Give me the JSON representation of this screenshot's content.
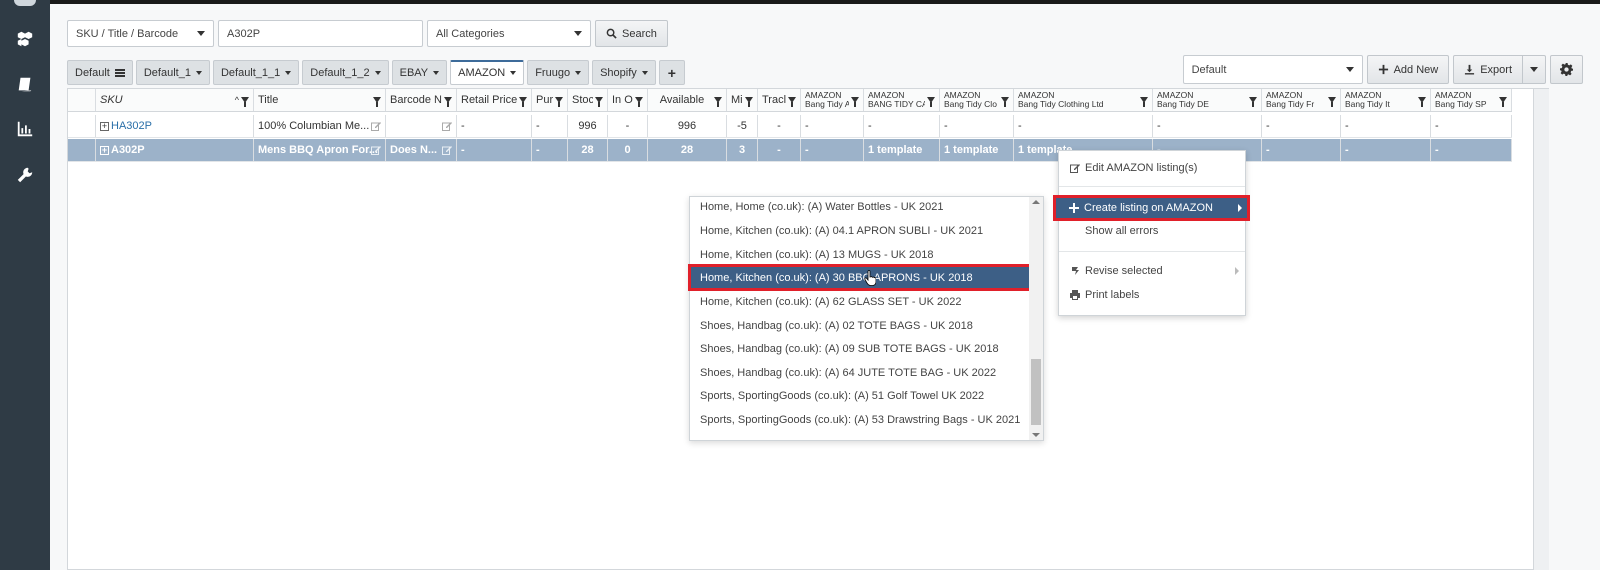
{
  "search": {
    "field_select": "SKU / Title / Barcode",
    "query": "A302P",
    "category_select": "All Categories",
    "search_label": "Search"
  },
  "tabs": [
    {
      "label": "Default"
    },
    {
      "label": "Default_1"
    },
    {
      "label": "Default_1_1"
    },
    {
      "label": "Default_1_2"
    },
    {
      "label": "EBAY"
    },
    {
      "label": "AMAZON"
    },
    {
      "label": "Fruugo"
    },
    {
      "label": "Shopify"
    },
    {
      "label": "+"
    }
  ],
  "toolbar": {
    "view_select": "Default",
    "add_new_label": "Add New",
    "export_label": "Export"
  },
  "grid": {
    "headers": [
      {
        "label": "SKU",
        "sub": ""
      },
      {
        "label": "Title",
        "sub": ""
      },
      {
        "label": "Barcode N",
        "sub": ""
      },
      {
        "label": "Retail Price",
        "sub": ""
      },
      {
        "label": "Purc",
        "sub": ""
      },
      {
        "label": "Stocl",
        "sub": ""
      },
      {
        "label": "In O",
        "sub": ""
      },
      {
        "label": "Available",
        "sub": ""
      },
      {
        "label": "Mi",
        "sub": ""
      },
      {
        "label": "Tracl",
        "sub": ""
      },
      {
        "label": "AMAZON",
        "sub": "Bang Tidy A"
      },
      {
        "label": "AMAZON",
        "sub": "BANG TIDY CA"
      },
      {
        "label": "AMAZON",
        "sub": "Bang Tidy Clo"
      },
      {
        "label": "AMAZON",
        "sub": "Bang Tidy Clothing Ltd"
      },
      {
        "label": "AMAZON",
        "sub": "Bang Tidy DE"
      },
      {
        "label": "AMAZON",
        "sub": "Bang Tidy Fr"
      },
      {
        "label": "AMAZON",
        "sub": "Bang Tidy It"
      },
      {
        "label": "AMAZON",
        "sub": "Bang Tidy SP"
      }
    ],
    "rows": [
      {
        "sku": "HA302P",
        "title": "100% Columbian Me...",
        "barcode": "",
        "retail": "-",
        "purchase": "-",
        "stock": "996",
        "in_order": "-",
        "available": "996",
        "min": "-5",
        "track": "-",
        "c1": "-",
        "c2": "-",
        "c3": "-",
        "c4": "-",
        "c5": "-",
        "c6": "-",
        "c7": "-",
        "c8": "-"
      },
      {
        "sku": "A302P",
        "title": "Mens BBQ Apron For...",
        "barcode": "Does N...",
        "retail": "-",
        "purchase": "-",
        "stock": "28",
        "in_order": "0",
        "available": "28",
        "min": "3",
        "track": "-",
        "c1": "-",
        "c2": "1 template",
        "c3": "1 template",
        "c4": "1 template",
        "c5": "-",
        "c6": "-",
        "c7": "-",
        "c8": "-"
      }
    ]
  },
  "template_list": [
    "Home, Home (co.uk): (A) Water Bottles - UK 2021",
    "Home, Kitchen (co.uk): (A) 04.1 APRON SUBLI - UK 2021",
    "Home, Kitchen (co.uk): (A) 13 MUGS - UK 2018",
    "Home, Kitchen (co.uk): (A) 30 BBQ APRONS - UK 2018",
    "Home, Kitchen (co.uk): (A) 62 GLASS SET - UK 2022",
    "Shoes, Handbag (co.uk): (A) 02 TOTE BAGS - UK 2018",
    "Shoes, Handbag (co.uk): (A) 09 SUB TOTE BAGS - UK 2018",
    "Shoes, Handbag (co.uk): (A) 64 JUTE TOTE BAG - UK 2022",
    "Sports, SportingGoods (co.uk): (A) 51 Golf Towel UK 2022",
    "Sports, SportingGoods (co.uk): (A) 53 Drawstring Bags - UK 2021"
  ],
  "context_menu": {
    "edit": "Edit AMAZON listing(s)",
    "create": "Create listing on AMAZON",
    "show_errors": "Show all errors",
    "revise": "Revise selected",
    "print": "Print labels"
  },
  "colors": {
    "sidebar": "#2f3b45",
    "selected_row": "#9cb2c9",
    "menu_highlight": "#3d5f86",
    "annotation_red": "#e0202a"
  }
}
